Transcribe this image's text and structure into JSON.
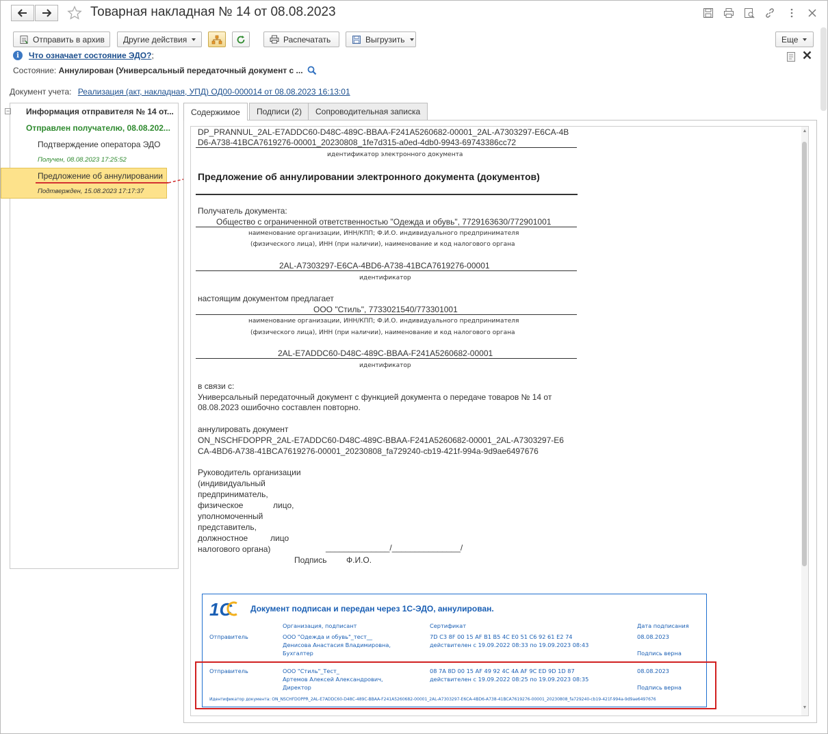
{
  "window": {
    "title": "Товарная накладная № 14 от 08.08.2023"
  },
  "toolbar": {
    "archive": "Отправить в архив",
    "other_actions": "Другие действия",
    "print": "Распечатать",
    "export": "Выгрузить",
    "more": "Еще"
  },
  "info": {
    "edo_link": "Что означает состояние ЭДО?",
    "edo_link_tail": ";",
    "state_label": "Состояние:",
    "state_value": "Аннулирован (Универсальный передаточный документ с ...",
    "doc_label": "Документ учета:",
    "doc_link": "Реализация (акт, накладная, УПД) ОД00-000014 от 08.08.2023 16:13:01"
  },
  "tree": {
    "root": "Информация отправителя № 14 от...",
    "sent": "Отправлен получателю, 08.08.202...",
    "operator": "Подтверждение оператора ЭДО",
    "operator_status": "Получен, 08.08.2023 17:25:52",
    "cancel": "Предложение об аннулировании",
    "cancel_status": "Подтвержден, 15.08.2023 17:17:37"
  },
  "tabs": {
    "content": "Содержимое",
    "signatures": "Подписи (2)",
    "note": "Сопроводительная записка"
  },
  "document": {
    "id_line1": "DP_PRANNUL_2AL-E7ADDC60-D48C-489C-BBAA-F241A5260682-00001_2AL-A7303297-E6CA-4B",
    "id_line2": "D6-A738-41BCA7619276-00001_20230808_1fe7d315-a0ed-4db0-9943-69743386cc72",
    "id_caption": "идентификатор электронного документа",
    "heading": "Предложение об аннулировании электронного документа (документов)",
    "recipient_label": "Получатель документа:",
    "recipient_name": "Общество с ограниченной ответственностью \"Одежда и обувь\", 7729163630/772901001",
    "org_caption1": "наименование организации, ИНН/КПП; Ф.И.О. индивидуального предпринимателя",
    "org_caption2": "(физического лица), ИНН (при наличии), наименование и код налогового органа",
    "recipient_id": "2AL-A7303297-E6CA-4BD6-A738-41BCA7619276-00001",
    "id_short_caption": "идентификатор",
    "propose_label": "настоящим документом предлагает",
    "sender_name": "ООО \"Стиль\", 7733021540/773301001",
    "sender_id": "2AL-E7ADDC60-D48C-489C-BBAA-F241A5260682-00001",
    "reason_label": "в связи с:",
    "reason_line1": "Универсальный передаточный документ с функцией документа о передаче товаров № 14 от",
    "reason_line2": "08.08.2023 ошибочно составлен повторно.",
    "cancel_label": "аннулировать документ",
    "cancel_line1": "ON_NSCHFDOPPR_2AL-E7ADDC60-D48C-489C-BBAA-F241A5260682-00001_2AL-A7303297-E6",
    "cancel_line2": "CA-4BD6-A738-41BCA7619276-00001_20230808_fa729240-cb19-421f-994a-9d9ae6497676",
    "head_1": "Руководитель  организации",
    "head_2": "(индивидуальный",
    "head_3": "предприниматель,",
    "head_4a": "физическое",
    "head_4b": "лицо,",
    "head_5": "уполномоченный",
    "head_6": "представитель,",
    "head_7a": "должностное",
    "head_7b": "лицо",
    "head_8": "налогового органа)",
    "sign_blank": "______________/_______________/",
    "sign_label": "Подпись",
    "fio_label": "Ф.И.О."
  },
  "stamp": {
    "logo": "1С",
    "header": "Документ подписан и передан через 1С-ЭДО, аннулирован.",
    "col_org": "Организация, подписант",
    "col_cert": "Сертификат",
    "col_date": "Дата подписания",
    "row1_role": "Отправитель",
    "row1_org": "ООО \"Одежда и обувь\"_тест__",
    "row1_person": "Денисова Анастасия Владимировна,",
    "row1_pos": "Бухгалтер",
    "row1_cert": "7D C3 8F 00 15 AF B1 B5 4C E0 51 C6 92 61 E2 74",
    "row1_valid": "действителен с 19.09.2022 08:33 по 19.09.2023 08:43",
    "row1_date": "08.08.2023",
    "row1_ok": "Подпись верна",
    "row2_role": "Отправитель",
    "row2_org": "ООО \"Стиль\"_Тест_",
    "row2_person": "Артемов  Алексей Александрович,",
    "row2_pos": "Директор",
    "row2_cert": "08 7A 8D 00 15 AF 49 92 4C 4A AF 9C ED 9D 1D 87",
    "row2_valid": "действителен с 19.09.2022 08:25 по 19.09.2023 08:35",
    "row2_date": "08.08.2023",
    "row2_ok": "Подпись верна",
    "doc_id": "Идентификатор документа: ON_NSCHFDOPPR_2AL-E7ADDC60-D48C-489C-BBAA-F241A5260682-00001_2AL-A7303297-E6CA-4BD6-A738-41BCA7619276-00001_20230808_fa729240-cb19-421f-994a-9d9ae6497676"
  },
  "colors": {
    "accent": "#1c4f8e",
    "green": "#2f8a2f",
    "selection": "#fde28b",
    "stamp_blue": "#1a5fb4",
    "highlight_red": "#d11f1f"
  },
  "icons": [
    "back-arrow-icon",
    "forward-arrow-icon",
    "star-icon",
    "save-icon",
    "print-icon",
    "preview-icon",
    "link-icon",
    "more-icon",
    "close-icon",
    "archive-icon",
    "structure-icon",
    "refresh-icon",
    "printer-icon",
    "export-icon",
    "info-icon",
    "search-icon",
    "note-icon",
    "close-x-icon"
  ]
}
